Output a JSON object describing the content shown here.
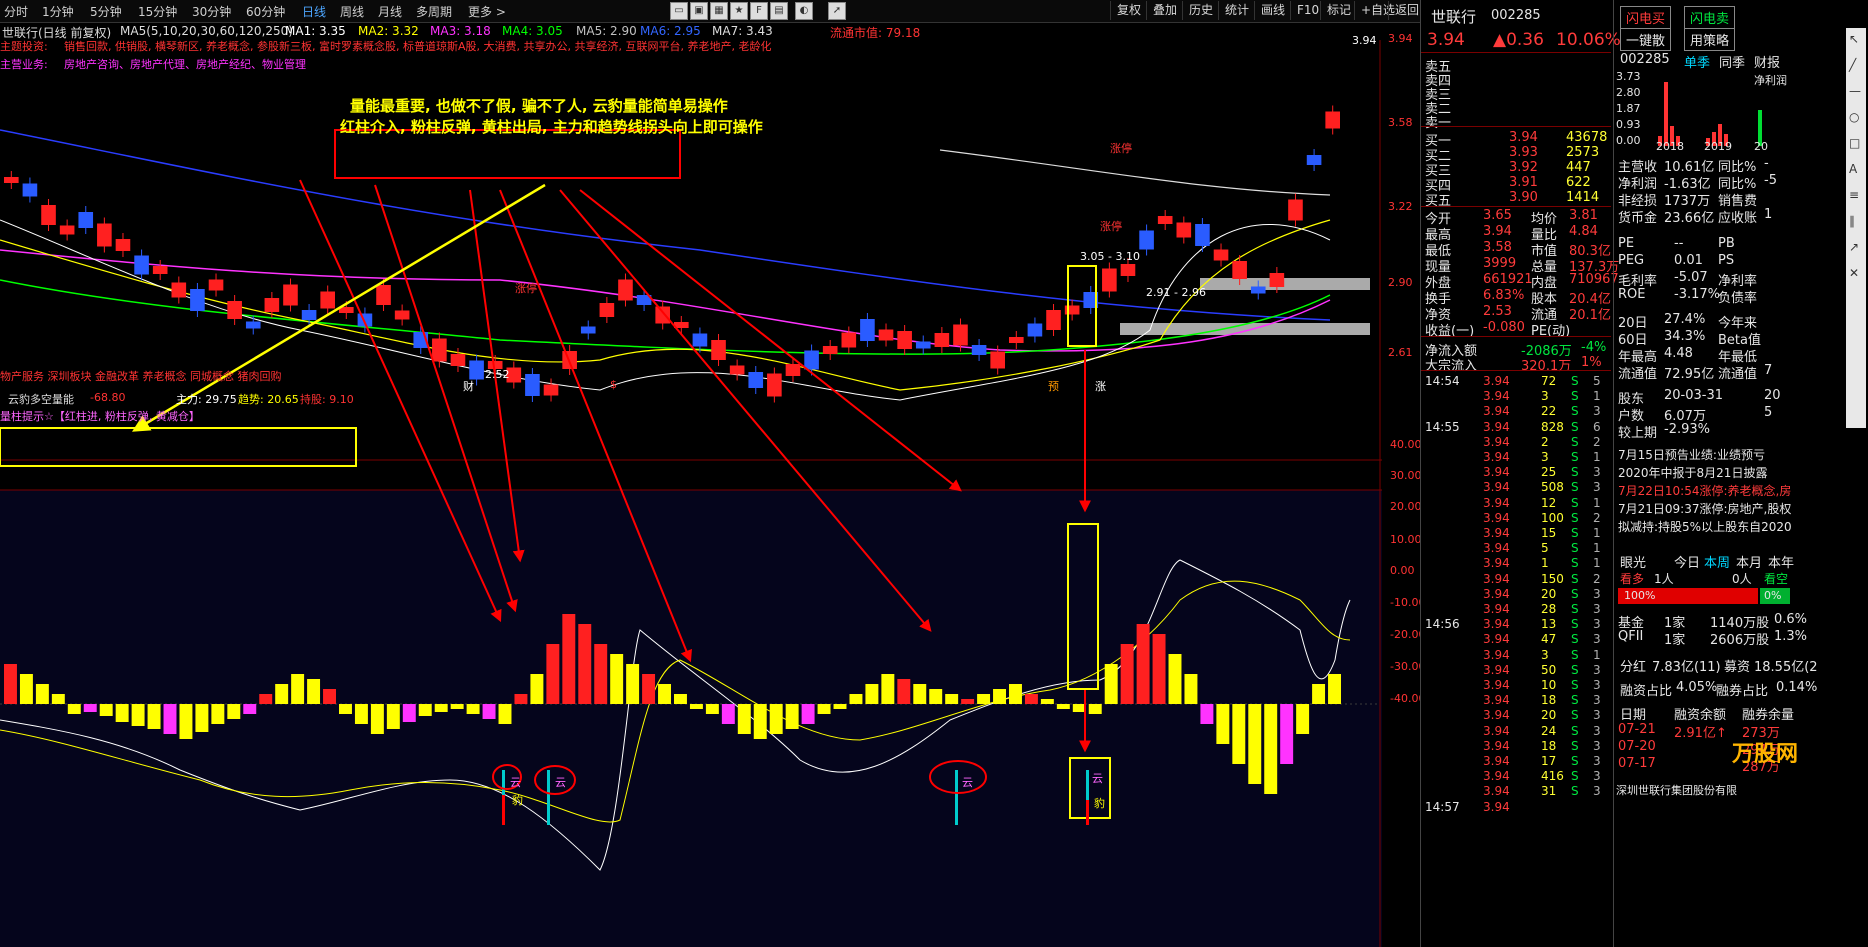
{
  "topbar": {
    "items": [
      "分时",
      "1分钟",
      "5分钟",
      "15分钟",
      "30分钟",
      "60分钟",
      "日线",
      "周线",
      "月线",
      "多周期",
      "更多 >"
    ],
    "active": "日线",
    "right_buttons": [
      "复权",
      "叠加",
      "历史",
      "统计",
      "画线",
      "F10",
      "标记",
      "+自选",
      "返回"
    ]
  },
  "maline": {
    "title": "世联行(日线 前复权)",
    "ma_label": "MA5(5,10,20,30,60,120,250)",
    "ma1": "MA1: 3.35",
    "ma2": "MA2: 3.32",
    "ma3": "MA3: 3.18",
    "ma4": "MA4: 3.05",
    "ma5": "MA5: 2.90",
    "ma6": "MA6: 2.95",
    "ma7": "MA7: 3.43",
    "float_cap": "流通市值: 79.18"
  },
  "concepts": {
    "line1_label": "主题投资:",
    "line1": "销售回款, 供销股, 横琴新区, 养老概念, 参股新三板, 富时罗素概念股, 标普道琼斯A股, 大消费, 共享办公, 共享经济, 互联网平台, 养老地产, 老龄化",
    "line2_label": "主营业务:",
    "line2": "房地产咨询、房地产代理、房地产经纪、物业管理",
    "line3": "物产服务 深圳板块 金融改革 养老概念 同城概念 猪肉回购"
  },
  "annotation": {
    "line1": "量能最重要, 也做不了假, 骗不了人, 云豹量能简单易操作",
    "line2": "红柱介入, 粉柱反弹, 黄柱出局, 主力和趋势线拐头向上即可操作"
  },
  "price_axis": [
    "3.94",
    "3.58",
    "3.22",
    "2.90",
    "2.61"
  ],
  "candle_labels": {
    "high": "3.94",
    "low": "2.52",
    "range": "2.91 - 2.96",
    "mid": "3.05 - 3.10",
    "limit1": "涨停",
    "limit2": "涨停",
    "zt": "涨停"
  },
  "indicator": {
    "name": "云豹多空量能",
    "value": "-68.80",
    "zhuli": "主力: 29.75",
    "qushi": "趋势: 20.65",
    "chicang": "持股: 9.10",
    "hint": "量柱提示☆【红柱进, 粉柱反弹, 黄减仓】",
    "axis": [
      "40.00",
      "30.00",
      "20.00",
      "10.00",
      "0.00",
      "-10.00",
      "-20.00",
      "-30.00",
      "-40.00"
    ]
  },
  "bottom_labels": {
    "c1": "云",
    "c2": "豹",
    "mark1": "财",
    "mark2": "$",
    "mark3": "预",
    "mark4": "涨"
  },
  "right_panel": {
    "name": "世联行",
    "code": "002285",
    "price": "3.94",
    "change": "▲0.36",
    "pct": "10.06%",
    "buttons": [
      "闪电买",
      "闪电卖",
      "一键散",
      "用策略"
    ],
    "sell": [
      {
        "label": "卖五",
        "price": "",
        "vol": ""
      },
      {
        "label": "卖四",
        "price": "",
        "vol": ""
      },
      {
        "label": "卖三",
        "price": "",
        "vol": ""
      },
      {
        "label": "卖二",
        "price": "",
        "vol": ""
      },
      {
        "label": "卖一",
        "price": "",
        "vol": ""
      }
    ],
    "buy": [
      {
        "label": "买一",
        "price": "3.94",
        "vol": "43678"
      },
      {
        "label": "买二",
        "price": "3.93",
        "vol": "2573"
      },
      {
        "label": "买三",
        "price": "3.92",
        "vol": "447"
      },
      {
        "label": "买四",
        "price": "3.91",
        "vol": "622"
      },
      {
        "label": "买五",
        "price": "3.90",
        "vol": "1414"
      }
    ],
    "stats": [
      {
        "l1": "今开",
        "v1": "3.65",
        "l2": "均价",
        "v2": "3.81"
      },
      {
        "l1": "最高",
        "v1": "3.94",
        "l2": "量比",
        "v2": "4.84"
      },
      {
        "l1": "最低",
        "v1": "3.58",
        "l2": "市值",
        "v2": "80.3亿"
      },
      {
        "l1": "现量",
        "v1": "3999",
        "l2": "总量",
        "v2": "137.3万"
      },
      {
        "l1": "外盘",
        "v1": "661921",
        "l2": "内盘",
        "v2": "710967"
      },
      {
        "l1": "换手",
        "v1": "6.83%",
        "l2": "股本",
        "v2": "20.4亿"
      },
      {
        "l1": "净资",
        "v1": "2.53",
        "l2": "流通",
        "v2": "20.1亿"
      },
      {
        "l1": "收益(一)",
        "v1": "-0.080",
        "l2": "PE(动)",
        "v2": ""
      }
    ],
    "flow": [
      {
        "label": "净流入额",
        "value": "-2086万",
        "pct": "-4%"
      },
      {
        "label": "大宗流入",
        "value": "320.1万",
        "pct": "1%"
      }
    ],
    "ticks": [
      {
        "time": "14:54",
        "price": "3.94",
        "vol": "72",
        "bs": "S",
        "n": "5"
      },
      {
        "time": "",
        "price": "3.94",
        "vol": "3",
        "bs": "S",
        "n": "1"
      },
      {
        "time": "",
        "price": "3.94",
        "vol": "22",
        "bs": "S",
        "n": "3"
      },
      {
        "time": "14:55",
        "price": "3.94",
        "vol": "828",
        "bs": "S",
        "n": "6"
      },
      {
        "time": "",
        "price": "3.94",
        "vol": "2",
        "bs": "S",
        "n": "2"
      },
      {
        "time": "",
        "price": "3.94",
        "vol": "3",
        "bs": "S",
        "n": "1"
      },
      {
        "time": "",
        "price": "3.94",
        "vol": "25",
        "bs": "S",
        "n": "3"
      },
      {
        "time": "",
        "price": "3.94",
        "vol": "508",
        "bs": "S",
        "n": "3"
      },
      {
        "time": "",
        "price": "3.94",
        "vol": "12",
        "bs": "S",
        "n": "1"
      },
      {
        "time": "",
        "price": "3.94",
        "vol": "100",
        "bs": "S",
        "n": "2"
      },
      {
        "time": "",
        "price": "3.94",
        "vol": "15",
        "bs": "S",
        "n": "1"
      },
      {
        "time": "",
        "price": "3.94",
        "vol": "5",
        "bs": "S",
        "n": "1"
      },
      {
        "time": "",
        "price": "3.94",
        "vol": "1",
        "bs": "S",
        "n": "1"
      },
      {
        "time": "",
        "price": "3.94",
        "vol": "150",
        "bs": "S",
        "n": "2"
      },
      {
        "time": "",
        "price": "3.94",
        "vol": "20",
        "bs": "S",
        "n": "3"
      },
      {
        "time": "",
        "price": "3.94",
        "vol": "28",
        "bs": "S",
        "n": "3"
      },
      {
        "time": "14:56",
        "price": "3.94",
        "vol": "13",
        "bs": "S",
        "n": "3"
      },
      {
        "time": "",
        "price": "3.94",
        "vol": "47",
        "bs": "S",
        "n": "3"
      },
      {
        "time": "",
        "price": "3.94",
        "vol": "3",
        "bs": "S",
        "n": "1"
      },
      {
        "time": "",
        "price": "3.94",
        "vol": "50",
        "bs": "S",
        "n": "3"
      },
      {
        "time": "",
        "price": "3.94",
        "vol": "10",
        "bs": "S",
        "n": "3"
      },
      {
        "time": "",
        "price": "3.94",
        "vol": "18",
        "bs": "S",
        "n": "3"
      },
      {
        "time": "",
        "price": "3.94",
        "vol": "20",
        "bs": "S",
        "n": "3"
      },
      {
        "time": "",
        "price": "3.94",
        "vol": "24",
        "bs": "S",
        "n": "3"
      },
      {
        "time": "",
        "price": "3.94",
        "vol": "18",
        "bs": "S",
        "n": "3"
      },
      {
        "time": "",
        "price": "3.94",
        "vol": "17",
        "bs": "S",
        "n": "3"
      },
      {
        "time": "",
        "price": "3.94",
        "vol": "416",
        "bs": "S",
        "n": "3"
      },
      {
        "time": "",
        "price": "3.94",
        "vol": "31",
        "bs": "S",
        "n": "3"
      },
      {
        "time": "14:57",
        "price": "3.94",
        "vol": "",
        "bs": "",
        "n": ""
      }
    ],
    "f10": {
      "code": "002285",
      "tabs": [
        "单季",
        "同季",
        "财报"
      ],
      "net_profit_label": "净利润",
      "yaxis": [
        "3.73",
        "2.80",
        "1.87",
        "0.93",
        "0.00"
      ],
      "years": [
        "2018",
        "2019",
        "20"
      ],
      "rows": [
        {
          "l1": "主营收",
          "v1": "10.61亿",
          "l2": "同比%",
          "v2": "-"
        },
        {
          "l1": "净利润",
          "v1": "-1.63亿",
          "l2": "同比%",
          "v2": "-5"
        },
        {
          "l1": "非经损",
          "v1": "1737万",
          "l2": "销售费",
          "v2": ""
        },
        {
          "l1": "货币金",
          "v1": "23.66亿",
          "l2": "应收账",
          "v2": "1"
        }
      ],
      "pe_rows": [
        {
          "l1": "PE",
          "v1": "--",
          "l2": "PB",
          "v2": ""
        },
        {
          "l1": "PEG",
          "v1": "0.01",
          "l2": "PS",
          "v2": ""
        },
        {
          "l1": "毛利率",
          "v1": "-5.07",
          "l2": "净利率",
          "v2": ""
        },
        {
          "l1": "ROE",
          "v1": "-3.17%",
          "l2": "负债率",
          "v2": ""
        }
      ],
      "perf": [
        {
          "l1": "20日",
          "v1": "27.4%",
          "l2": "今年来",
          "v2": ""
        },
        {
          "l1": "60日",
          "v1": "34.3%",
          "l2": "Beta值",
          "v2": ""
        },
        {
          "l1": "年最高",
          "v1": "4.48",
          "l2": "年最低",
          "v2": ""
        },
        {
          "l1": "流通值",
          "v1": "72.95亿",
          "l2": "流通值",
          "v2": "7"
        }
      ],
      "holders": [
        {
          "l1": "股东",
          "v1": "20-03-31",
          "v2": "20"
        },
        {
          "l1": "户数",
          "v1": "6.07万",
          "v2": "5"
        },
        {
          "l1": "较上期",
          "v1": "-2.93%",
          "v2": ""
        }
      ],
      "news": [
        "7月15日预告业绩:业绩预亏",
        "2020年中报于8月21日披露",
        "7月22日10:54涨停:养老概念,房",
        "7月21日09:37涨停:房地产,股权",
        "拟减持:持股5%以上股东自2020"
      ],
      "sentiment": {
        "label": "眼光",
        "tabs": [
          "今日",
          "本周",
          "本月",
          "本年"
        ],
        "bull": "看多",
        "bull_n": "1人",
        "bear_n": "0人",
        "bear": "看空",
        "bull_pct": "100%",
        "bear_pct": "0%"
      },
      "funds": [
        {
          "l1": "基金",
          "v1": "1家",
          "v2": "1140万股",
          "v3": "0.6%"
        },
        {
          "l1": "QFII",
          "v1": "1家",
          "v2": "2606万股",
          "v3": "1.3%"
        }
      ],
      "dividend": {
        "l1": "分红",
        "v1": "7.83亿(11)",
        "l2": "募资",
        "v2": "18.55亿(2"
      },
      "margin": {
        "l1": "融资占比",
        "v1": "4.05%",
        "l2": "融券占比",
        "v2": "0.14%"
      },
      "margin_head": [
        "日期",
        "融资余额",
        "融券余量"
      ],
      "margin_rows": [
        {
          "d": "07-21",
          "v1": "2.91亿↑",
          "v2": "273万"
        },
        {
          "d": "07-20",
          "v1": "",
          "v2": "294万"
        },
        {
          "d": "07-17",
          "v1": "",
          "v2": "287万"
        }
      ],
      "footer": "深圳世联行集团股份有限"
    },
    "watermark": "万股网"
  }
}
